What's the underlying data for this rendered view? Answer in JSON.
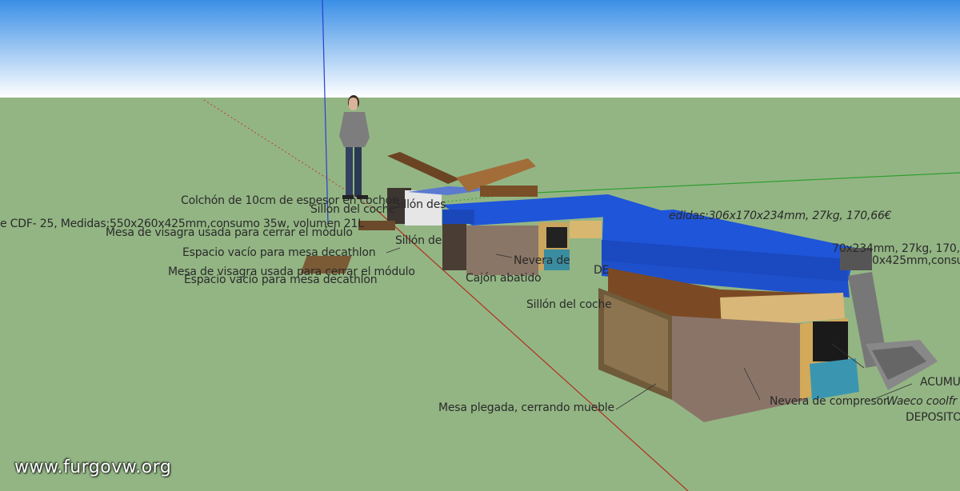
{
  "labels": {
    "colchon": "Colchón de 10cm de espesor en cochon",
    "sillon_top": "Sillón del coche",
    "cdf": "e CDF- 25, Medidas:550x260x425mm,consumo 35w, volumen 21L",
    "sillon_des": "Sillón des",
    "mesa_visagra_1": "Mesa de visagra usada para cerrar el módulo",
    "sillon_de": "Sillón de",
    "medidas_right": "edidas:306x170x234mm, 27kg,  170,66€",
    "espacio_1": "Espacio vacío para mesa decathlon",
    "nevera_de": "Nevera de",
    "de_small": "DE",
    "medidas_right2": "70x234mm, 27kg,  170,",
    "medidas_right3": "0x425mm,consu",
    "mesa_visagra_2": "Mesa de visagra usada para cerrar el módulo",
    "espacio_2": "Espacio vacío para mesa decathlon",
    "cajon": "Cajón abatido",
    "sillon_bottom": "Sillón del coche",
    "acumu": "ACUMU",
    "nevera_compresor": "Nevera de compresor",
    "waeco": "Waeco coolfr",
    "deposito": "DEPOSITO",
    "mesa_plegada": "Mesa plegada, cerrando mueble"
  },
  "watermark": "www.furgovw.org",
  "colors": {
    "sky_top": "#3a8fe6",
    "sky_bottom": "#ffffff",
    "ground": "#93b584",
    "blue_cushion": "#1f55d8",
    "wood": "#8a5a2e",
    "axis_red": "#c0392b",
    "axis_green": "#2e9e2e",
    "axis_blue": "#2a3fd0"
  }
}
